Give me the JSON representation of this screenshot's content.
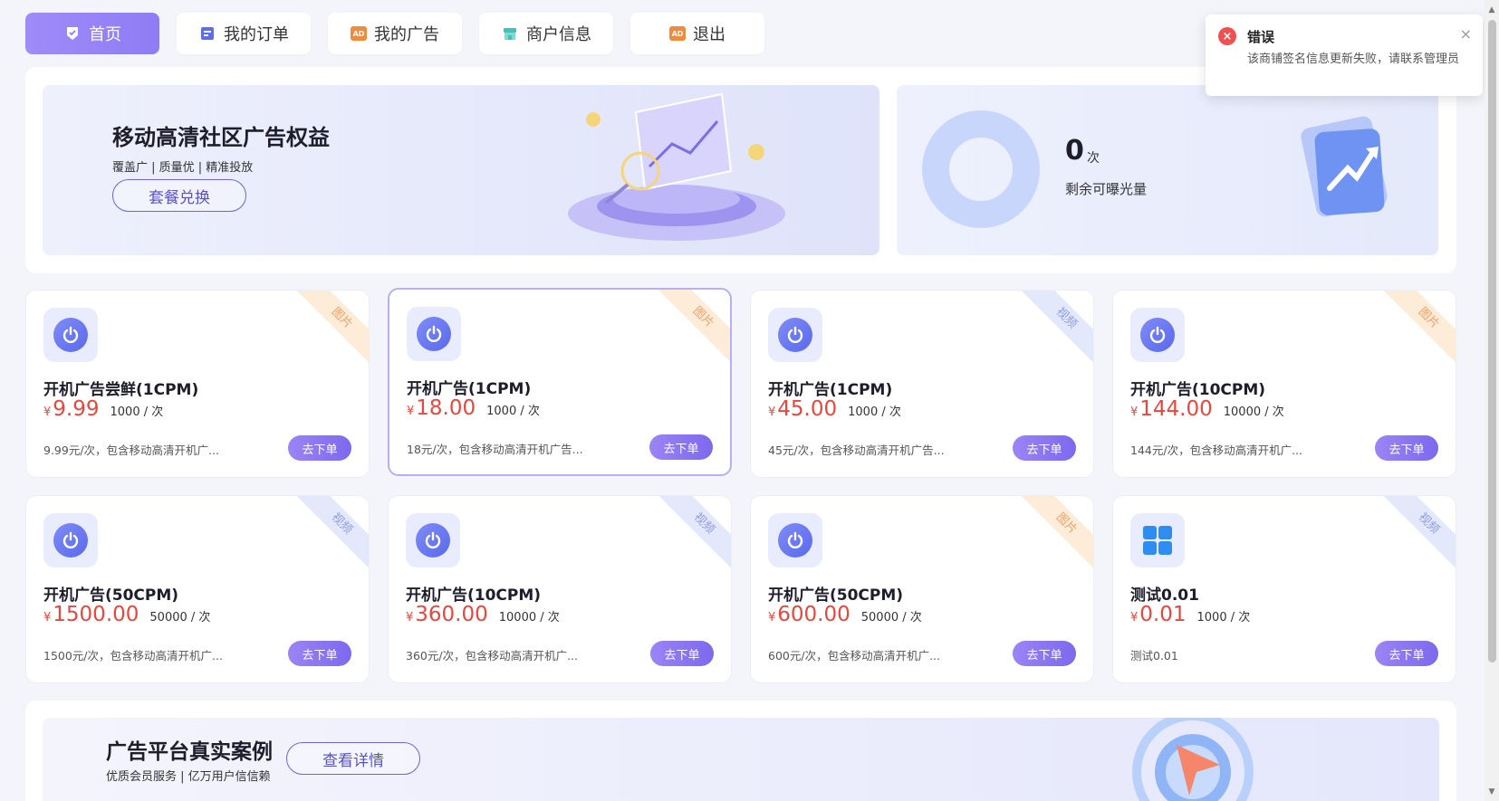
{
  "nav": [
    {
      "label": "首页",
      "icon": "home-badge-icon",
      "active": true
    },
    {
      "label": "我的订单",
      "icon": "order-icon",
      "active": false
    },
    {
      "label": "我的广告",
      "icon": "ad-icon",
      "active": false
    },
    {
      "label": "商户信息",
      "icon": "store-icon",
      "active": false
    },
    {
      "label": "退出",
      "icon": "ad-icon",
      "active": false
    }
  ],
  "ad_tag_text": "AD",
  "hero": {
    "title": "移动高清社区广告权益",
    "subtitle": "覆盖广 | 质量优 | 精准投放",
    "button": "套餐兑换"
  },
  "stats": {
    "value": "0",
    "unit": "次",
    "label": "剩余可曝光量"
  },
  "products": [
    {
      "title": "开机广告尝鲜(1CPM)",
      "currency": "¥",
      "price": "9.99",
      "unit": "1000 / 次",
      "desc": "9.99元/次，包含移动高清开机广...",
      "tag": "图片",
      "tag_type": "pic",
      "icon": "power-icon",
      "button": "去下单"
    },
    {
      "title": "开机广告(1CPM)",
      "currency": "¥",
      "price": "18.00",
      "unit": "1000 / 次",
      "desc": "18元/次，包含移动高清开机广告...",
      "tag": "图片",
      "tag_type": "pic",
      "icon": "power-icon",
      "button": "去下单"
    },
    {
      "title": "开机广告(1CPM)",
      "currency": "¥",
      "price": "45.00",
      "unit": "1000 / 次",
      "desc": "45元/次，包含移动高清开机广告...",
      "tag": "视频",
      "tag_type": "vid",
      "icon": "power-icon",
      "button": "去下单"
    },
    {
      "title": "开机广告(10CPM)",
      "currency": "¥",
      "price": "144.00",
      "unit": "10000 / 次",
      "desc": "144元/次，包含移动高清开机广...",
      "tag": "图片",
      "tag_type": "pic",
      "icon": "power-icon",
      "button": "去下单"
    },
    {
      "title": "开机广告(50CPM)",
      "currency": "¥",
      "price": "1500.00",
      "unit": "50000 / 次",
      "desc": "1500元/次，包含移动高清开机广...",
      "tag": "视频",
      "tag_type": "vid",
      "icon": "power-icon",
      "button": "去下单"
    },
    {
      "title": "开机广告(10CPM)",
      "currency": "¥",
      "price": "360.00",
      "unit": "10000 / 次",
      "desc": "360元/次，包含移动高清开机广...",
      "tag": "视频",
      "tag_type": "vid",
      "icon": "power-icon",
      "button": "去下单"
    },
    {
      "title": "开机广告(50CPM)",
      "currency": "¥",
      "price": "600.00",
      "unit": "50000 / 次",
      "desc": "600元/次，包含移动高清开机广...",
      "tag": "图片",
      "tag_type": "pic",
      "icon": "power-icon",
      "button": "去下单"
    },
    {
      "title": "测试0.01",
      "currency": "¥",
      "price": "0.01",
      "unit": "1000 / 次",
      "desc": "测试0.01",
      "tag": "视频",
      "tag_type": "vid",
      "icon": "grid-icon",
      "button": "去下单"
    }
  ],
  "cases": {
    "title": "广告平台真实案例",
    "subtitle": "优质会员服务 | 亿万用户信信赖",
    "button": "查看详情"
  },
  "toast": {
    "title": "错误",
    "message": "该商铺签名信息更新失败，请联系管理员",
    "close": "×"
  },
  "colors": {
    "accent": "#8f7cf5",
    "price": "#e8473e",
    "error": "#f05050"
  }
}
